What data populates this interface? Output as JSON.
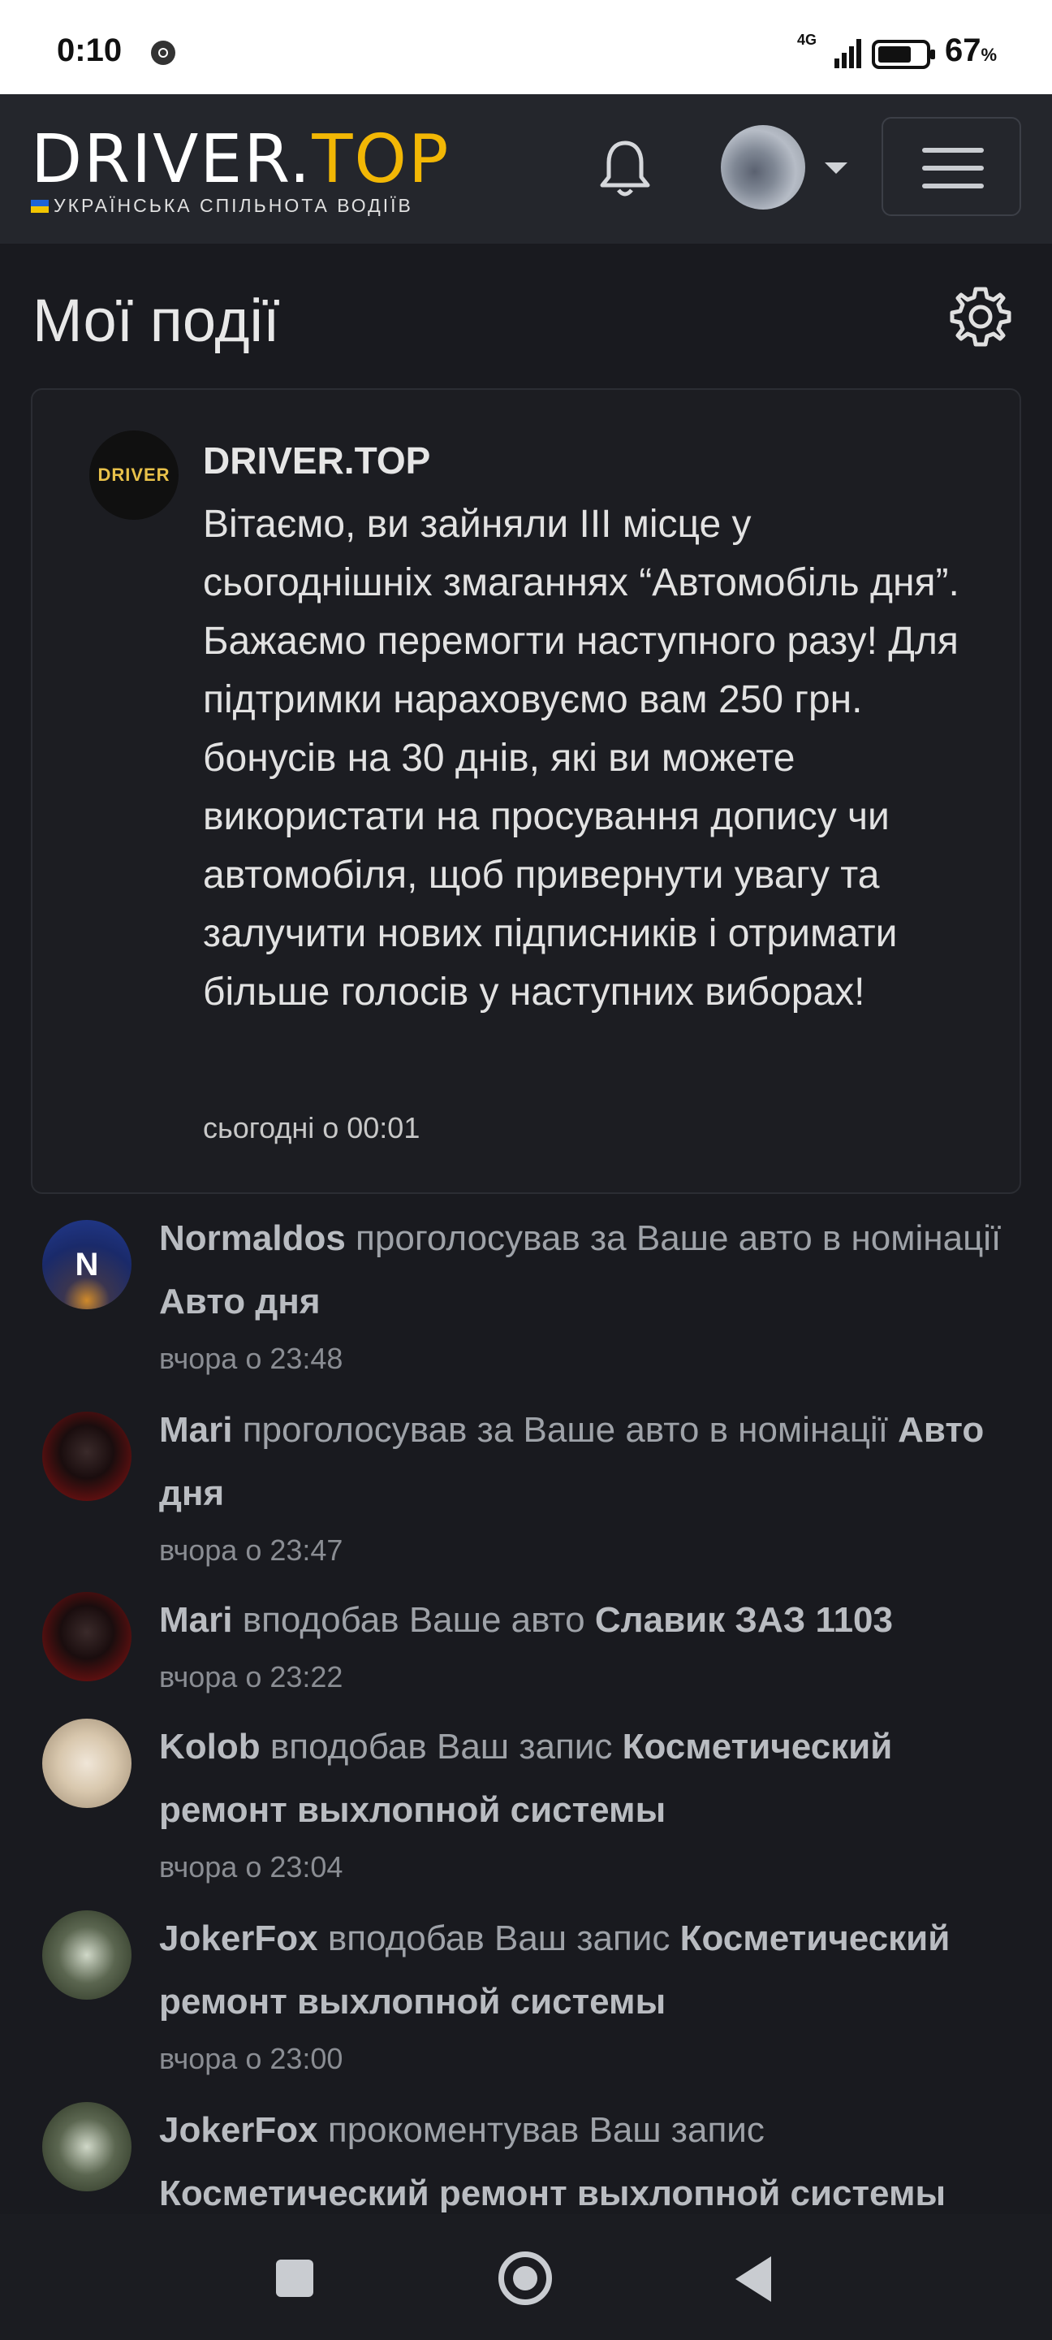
{
  "status_bar": {
    "time": "0:10",
    "network": "4G",
    "battery_percent": "67",
    "battery_unit": "%"
  },
  "header": {
    "logo_left": "DRIVER.",
    "logo_right": "TOP",
    "logo_tagline": "УКРАЇНСЬКА СПІЛЬНОТА ВОДІЇВ",
    "icons": [
      "bell-icon",
      "avatar",
      "chevron-down-icon",
      "menu-icon"
    ]
  },
  "page": {
    "title": "Мої події",
    "settings_icon": "gear-icon"
  },
  "featured": {
    "logo_text": "DRIVER",
    "author": "DRIVER.TOP",
    "message": "Вітаємо, ви зайняли ІІІ місце у сьогоднішніх змаганнях “Автомобіль дня”. Бажаємо перемогти наступного разу! Для підтримки нараховуємо вам 250 грн. бонусів на 30 днів, які ви можете використати на просування допису чи автомобіля, щоб привернути увагу та залучити нових підписників і отримати більше голосів у наступних виборах!",
    "time": "сьогодні о 00:01"
  },
  "events": [
    {
      "avatar_letter": "N",
      "user": "Normaldos",
      "action": " проголосував за Ваше авто в номінації ",
      "target": "Авто дня",
      "time": "вчора о 23:48"
    },
    {
      "avatar_letter": "",
      "user": "Mari",
      "action": " проголосував за Ваше авто в номінації ",
      "target": "Авто дня",
      "time": "вчора о 23:47"
    },
    {
      "avatar_letter": "",
      "user": "Mari",
      "action": " вподобав Ваше авто ",
      "target": "Славик ЗАЗ 1103",
      "time": "вчора о 23:22"
    },
    {
      "avatar_letter": "",
      "user": "Kolob",
      "action": " вподобав Ваш запис ",
      "target": "Косметический ремонт выхлопной системы",
      "time": "вчора о 23:04"
    },
    {
      "avatar_letter": "",
      "user": "JokerFox",
      "action": " вподобав Ваш запис ",
      "target": "Косметический ремонт выхлопной системы",
      "time": "вчора о 23:00"
    },
    {
      "avatar_letter": "",
      "user": "JokerFox",
      "action": " прокоментував Ваш запис ",
      "target": "Косметический ремонт выхлопной системы",
      "time": ""
    }
  ],
  "nav": {
    "icons": [
      "recents-icon",
      "home-icon",
      "back-icon"
    ]
  }
}
